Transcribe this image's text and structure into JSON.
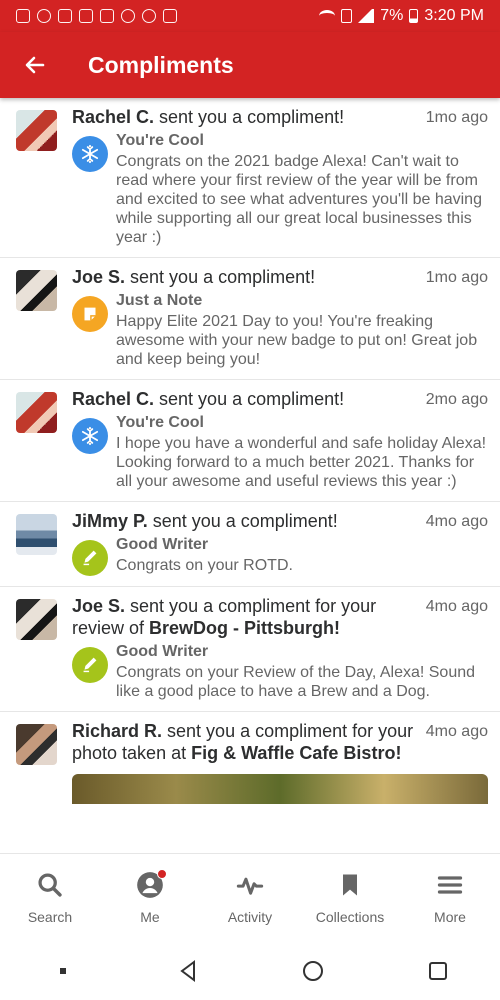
{
  "status_bar": {
    "battery": "7%",
    "time": "3:20 PM"
  },
  "header": {
    "title": "Compliments"
  },
  "feed": [
    {
      "avatar": "rachel",
      "name": "Rachel C.",
      "action": " sent you a compliment!",
      "time": "1mo ago",
      "type": "You're Cool",
      "icon": "snowflake-icon",
      "message": "Congrats on the 2021 badge Alexa! Can't wait to read where your first review of the year will be from and excited to see what adventures you'll be having while supporting all our great local businesses this year :)"
    },
    {
      "avatar": "joe",
      "name": "Joe S.",
      "action": " sent you a compliment!",
      "time": "1mo ago",
      "type": "Just a Note",
      "icon": "note-icon",
      "message": "Happy Elite 2021 Day to you! You're freaking awesome with your new badge to put on! Great job and keep being you!"
    },
    {
      "avatar": "rachel",
      "name": "Rachel C.",
      "action": " sent you a compliment!",
      "time": "2mo ago",
      "type": "You're Cool",
      "icon": "snowflake-icon",
      "message": "I hope you have a wonderful and safe holiday Alexa! Looking forward to a much better 2021. Thanks for all your awesome and useful reviews this year :)"
    },
    {
      "avatar": "jimmy",
      "name": "JiMmy P.",
      "action": " sent you a compliment!",
      "time": "4mo ago",
      "type": "Good Writer",
      "icon": "pencil-icon",
      "message": "Congrats on your ROTD."
    },
    {
      "avatar": "joe",
      "name": "Joe S.",
      "action": " sent you a compliment for your review of ",
      "business": "BrewDog - Pittsburgh!",
      "time": "4mo ago",
      "type": "Good Writer",
      "icon": "pencil-icon",
      "message": "Congrats on your Review of the Day, Alexa! Sound like a good place to have a Brew and a Dog."
    },
    {
      "avatar": "richard",
      "name": "Richard R.",
      "action": " sent you a compliment for your photo taken at ",
      "business": "Fig & Waffle Cafe Bistro!",
      "time": "4mo ago"
    }
  ],
  "bottom_nav": [
    {
      "label": "Search",
      "icon": "search-icon"
    },
    {
      "label": "Me",
      "icon": "user-icon"
    },
    {
      "label": "Activity",
      "icon": "activity-icon"
    },
    {
      "label": "Collections",
      "icon": "bookmark-icon"
    },
    {
      "label": "More",
      "icon": "menu-icon"
    }
  ],
  "colors": {
    "brand": "#d32323",
    "cool": "#3a8ee6",
    "note": "#f5a623",
    "writer": "#a5c41b"
  }
}
